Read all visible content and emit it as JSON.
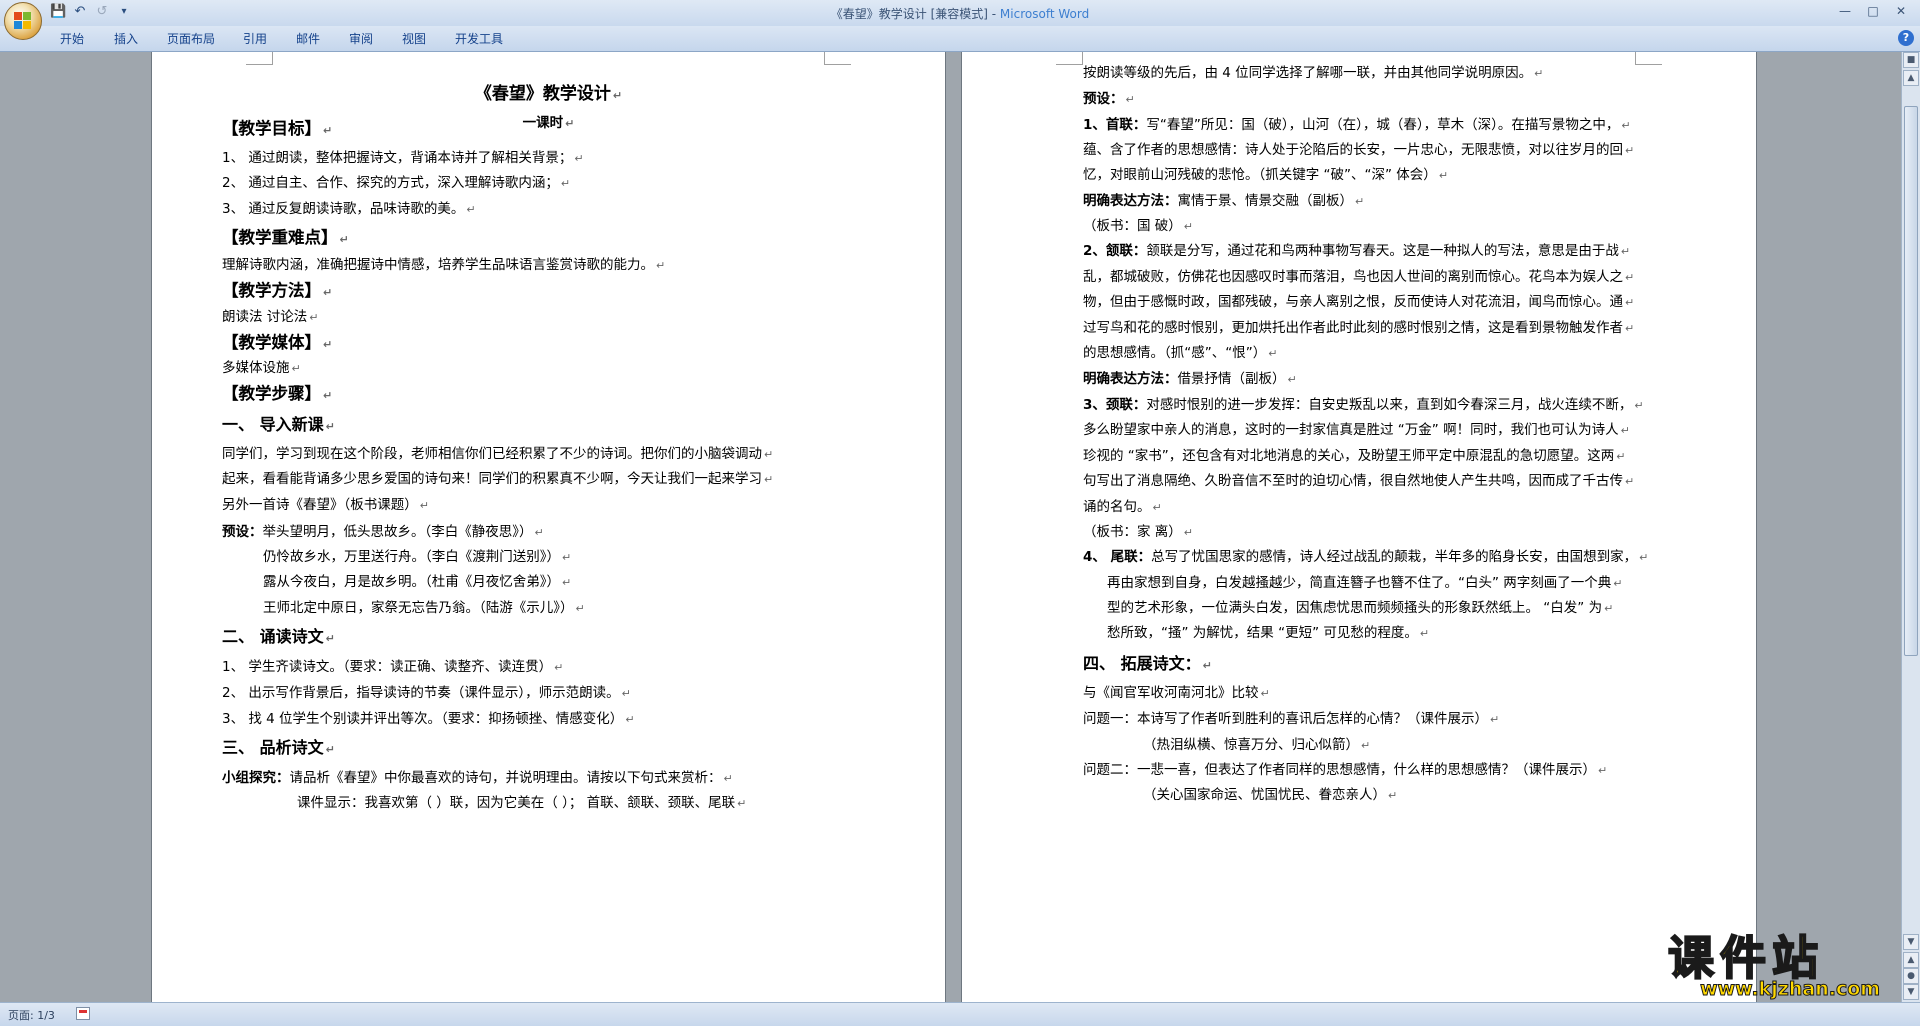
{
  "window": {
    "title_doc": "《春望》教学设计 [兼容模式] - ",
    "title_app": "Microsoft Word"
  },
  "quick_access": {
    "save_icon": "save-icon",
    "undo_icon": "undo-icon",
    "redo_icon": "redo-icon",
    "customize_icon": "dropdown-icon"
  },
  "ribbon_tabs": [
    "开始",
    "插入",
    "页面布局",
    "引用",
    "邮件",
    "审阅",
    "视图",
    "开发工具"
  ],
  "status": {
    "page": "页面: 1/3"
  },
  "watermark": {
    "chars": "课件站",
    "url": "www.kjzhan.com"
  },
  "left_page": {
    "title": "《春望》教学设计",
    "subtitle": "一课时",
    "lines": [
      {
        "kind": "h2",
        "text": "【教学目标】"
      },
      {
        "kind": "p",
        "text": "1、 通过朗读，整体把握诗文，背诵本诗并了解相关背景；"
      },
      {
        "kind": "p",
        "text": "2、 通过自主、合作、探究的方式，深入理解诗歌内涵；"
      },
      {
        "kind": "p",
        "text": "3、 通过反复朗读诗歌，品味诗歌的美。"
      },
      {
        "kind": "h2",
        "text": "【教学重难点】"
      },
      {
        "kind": "p",
        "text": "理解诗歌内涵，准确把握诗中情感，培养学生品味语言鉴赏诗歌的能力。"
      },
      {
        "kind": "h2",
        "text": "【教学方法】"
      },
      {
        "kind": "p",
        "text": "朗读法    讨论法"
      },
      {
        "kind": "h2",
        "text": "【教学媒体】"
      },
      {
        "kind": "p",
        "text": "多媒体设施"
      },
      {
        "kind": "h2",
        "text": "【教学步骤】"
      },
      {
        "kind": "h3",
        "text": "一、  导入新课"
      },
      {
        "kind": "p",
        "text": "同学们，学习到现在这个阶段，老师相信你们已经积累了不少的诗词。把你们的小脑袋调动"
      },
      {
        "kind": "p",
        "text": "起来，看看能背诵多少思乡爱国的诗句来！同学们的积累真不少啊，今天让我们一起来学习"
      },
      {
        "kind": "p",
        "text": "另外一首诗《春望》（板书课题）"
      },
      {
        "kind": "pb",
        "bold": "预设：",
        "text": "举头望明月，低头思故乡。（李白《静夜思》）"
      },
      {
        "kind": "pi",
        "text": "仍怜故乡水，万里送行舟。（李白《渡荆门送别》）"
      },
      {
        "kind": "pi",
        "text": "露从今夜白，月是故乡明。（杜甫《月夜忆舍弟》）"
      },
      {
        "kind": "pi",
        "text": "王师北定中原日，家祭无忘告乃翁。（陆游《示儿》）"
      },
      {
        "kind": "h3",
        "text": "二、  诵读诗文"
      },
      {
        "kind": "p",
        "text": "1、 学生齐读诗文。（要求：读正确、读整齐、读连贯）"
      },
      {
        "kind": "p",
        "text": "2、 出示写作背景后，指导读诗的节奏（课件显示），师示范朗读。"
      },
      {
        "kind": "p",
        "text": "3、 找 4 位学生个别读并评出等次。（要求：抑扬顿挫、情感变化）"
      },
      {
        "kind": "h3",
        "text": "三、  品析诗文"
      },
      {
        "kind": "pb",
        "bold": "小组探究：",
        "text": "请品析《春望》中你最喜欢的诗句，并说明理由。请按以下句式来赏析："
      },
      {
        "kind": "pc",
        "text": "课件显示：我喜欢第（  ）联，因为它美在（  ）；    首联、颔联、颈联、尾联"
      }
    ]
  },
  "right_page": {
    "lines": [
      {
        "kind": "p",
        "text": "按朗读等级的先后，由 4 位同学选择了解哪一联，并由其他同学说明原因。"
      },
      {
        "kind": "pb",
        "bold": "预设：",
        "text": ""
      },
      {
        "kind": "pb",
        "bold": "1、首联：",
        "text": "写“春望”所见：国（破），山河（在），城（春），草木（深）。在描写景物之中，"
      },
      {
        "kind": "p",
        "text": "蕴、含了作者的思想感情：诗人处于沦陷后的长安，一片忠心，无限悲愤，对以往岁月的回"
      },
      {
        "kind": "p",
        "text": "忆，对眼前山河残破的悲怆。（抓关键字 “破”、“深” 体会）"
      },
      {
        "kind": "pb",
        "bold": "明确表达方法：",
        "text": "寓情于景、情景交融（副板）"
      },
      {
        "kind": "p",
        "text": "（板书：国  破）"
      },
      {
        "kind": "pb",
        "bold": "2、颔联：",
        "text": "颔联是分写，通过花和鸟两种事物写春天。这是一种拟人的写法，意思是由于战"
      },
      {
        "kind": "p",
        "text": "乱，都城破败，仿佛花也因感叹时事而落泪，鸟也因人世间的离别而惊心。花鸟本为娱人之"
      },
      {
        "kind": "p",
        "text": "物，但由于感慨时政，国都残破，与亲人离别之恨，反而使诗人对花流泪，闻鸟而惊心。通"
      },
      {
        "kind": "p",
        "text": "过写鸟和花的感时恨别，更加烘托出作者此时此刻的感时恨别之情，这是看到景物触发作者"
      },
      {
        "kind": "p",
        "text": "的思想感情。（抓“感”、“恨”）"
      },
      {
        "kind": "pb",
        "bold": "明确表达方法：",
        "text": "借景抒情（副板）"
      },
      {
        "kind": "pb",
        "bold": "3、颈联：",
        "text": "对感时恨别的进一步发挥：自安史叛乱以来，直到如今春深三月，战火连续不断，"
      },
      {
        "kind": "p",
        "text": "多么盼望家中亲人的消息，这时的一封家信真是胜过 “万金” 啊！同时，我们也可认为诗人"
      },
      {
        "kind": "p",
        "text": "珍视的 “家书”，还包含有对北地消息的关心，及盼望王师平定中原混乱的急切愿望。这两"
      },
      {
        "kind": "p",
        "text": "句写出了消息隔绝、久盼音信不至时的迫切心情，很自然地使人产生共鸣，因而成了千古传"
      },
      {
        "kind": "p",
        "text": "诵的名句。"
      },
      {
        "kind": "p",
        "text": "（板书：家    离）"
      },
      {
        "kind": "pb",
        "bold": "4、 尾联：",
        "text": "总写了忧国思家的感情，诗人经过战乱的颠栽，半年多的陷身长安，由国想到家，"
      },
      {
        "kind": "pi2",
        "text": "再由家想到自身，白发越搔越少，简直连簪子也簪不住了。“白头” 两字刻画了一个典"
      },
      {
        "kind": "pi2",
        "text": "型的艺术形象，一位满头白发，因焦虑忧思而频频搔头的形象跃然纸上。 “白发” 为"
      },
      {
        "kind": "pi2",
        "text": "愁所致，“搔” 为解忧，结果 “更短” 可见愁的程度。"
      },
      {
        "kind": "h3",
        "text": "四、  拓展诗文："
      },
      {
        "kind": "p",
        "text": "与《闻官军收河南河北》比较"
      },
      {
        "kind": "p",
        "text": "问题一：本诗写了作者听到胜利的喜讯后怎样的心情？（课件展示）"
      },
      {
        "kind": "pi3",
        "text": "（热泪纵横、惊喜万分、归心似箭）"
      },
      {
        "kind": "p",
        "text": "问题二：一悲一喜，但表达了作者同样的思想感情，什么样的思想感情？（课件展示）"
      },
      {
        "kind": "pi3",
        "text": "（关心国家命运、忧国忧民、眷恋亲人）"
      }
    ]
  },
  "colors": {
    "watermark_yellow": "#ffd800",
    "ribbon_text": "#15428b",
    "doc_bg": "#9fa6ad"
  }
}
